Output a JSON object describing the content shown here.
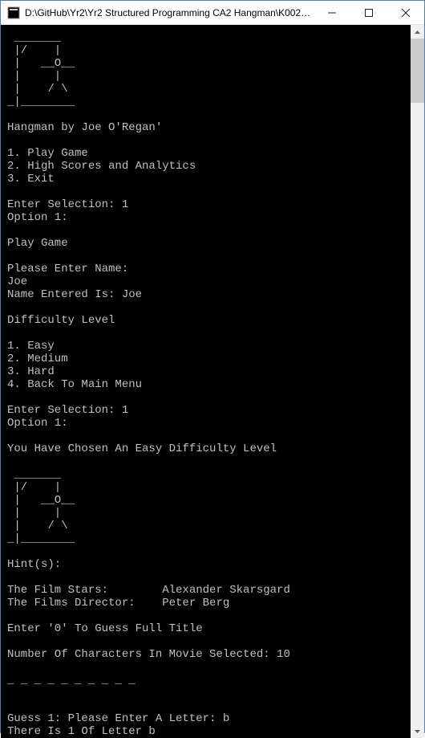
{
  "window": {
    "title": "D:\\GitHub\\Yr2\\Yr2 Structured Programming CA2 Hangman\\K0020..."
  },
  "console": {
    "lines": [
      " _______",
      " |/    |",
      " |   __O__",
      " |     |",
      " |    / \\",
      "_|________",
      "",
      "Hangman by Joe O'Regan'",
      "",
      "1. Play Game",
      "2. High Scores and Analytics",
      "3. Exit",
      "",
      "Enter Selection: 1",
      "Option 1:",
      "",
      "Play Game",
      "",
      "Please Enter Name:",
      "Joe",
      "Name Entered Is: Joe",
      "",
      "Difficulty Level",
      "",
      "1. Easy",
      "2. Medium",
      "3. Hard",
      "4. Back To Main Menu",
      "",
      "Enter Selection: 1",
      "Option 1:",
      "",
      "You Have Chosen An Easy Difficulty Level",
      "",
      " _______",
      " |/    |",
      " |   __O__",
      " |     |",
      " |    / \\",
      "_|________",
      "",
      "Hint(s):",
      "",
      "The Film Stars:        Alexander Skarsgard",
      "The Films Director:    Peter Berg",
      "",
      "Enter '0' To Guess Full Title",
      "",
      "Number Of Characters In Movie Selected: 10",
      "",
      "_ _ _ _ _ _ _ _ _ _",
      "",
      "",
      "Guess 1: Please Enter A Letter: b",
      "There Is 1 Of Letter b"
    ]
  }
}
